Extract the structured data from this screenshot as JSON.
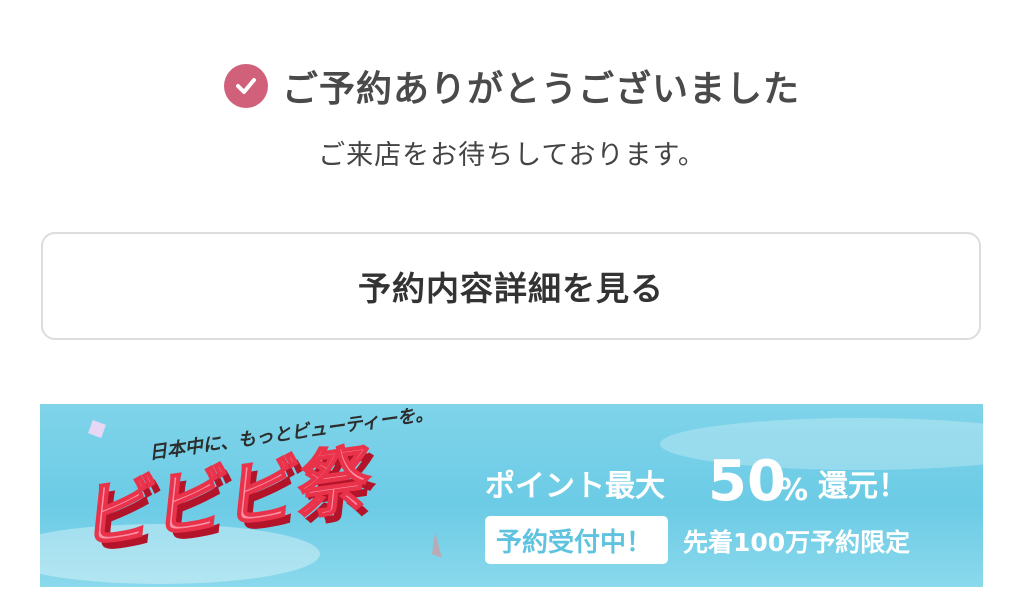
{
  "confirmation": {
    "title": "ご予約ありがとうございました",
    "message": "ご来店をお待ちしております。"
  },
  "details_button": {
    "label": "予約内容詳細を見る"
  },
  "banner": {
    "tagline": "日本中に、もっとビューティーを。",
    "logo_text": "ビビビ祭",
    "headline_prefix": "ポイント最大",
    "headline_number": "50",
    "headline_percent": "%",
    "headline_suffix": "還元！",
    "badge": "予約受付中！",
    "note": "先着100万予約限定"
  },
  "colors": {
    "accent": "#d1607a",
    "banner_sky": "#6ccbe5",
    "logo_red": "#e8334a",
    "logo_pink": "#ff8fa5"
  },
  "icons": {
    "confirm": "check-circle-icon"
  }
}
